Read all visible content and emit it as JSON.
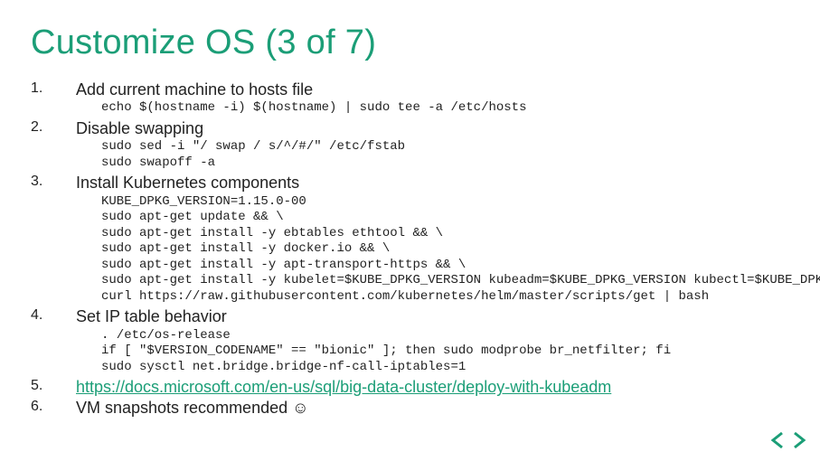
{
  "title": "Customize OS (3 of 7)",
  "items": [
    {
      "num": "1.",
      "heading": "Add current machine to hosts file",
      "code": "echo $(hostname -i) $(hostname) | sudo tee -a /etc/hosts"
    },
    {
      "num": "2.",
      "heading": "Disable swapping",
      "code": "sudo sed -i \"/ swap / s/^/#/\" /etc/fstab\nsudo swapoff -a"
    },
    {
      "num": "3.",
      "heading": "Install Kubernetes components",
      "code": "KUBE_DPKG_VERSION=1.15.0-00\nsudo apt-get update && \\\nsudo apt-get install -y ebtables ethtool && \\\nsudo apt-get install -y docker.io && \\\nsudo apt-get install -y apt-transport-https && \\\nsudo apt-get install -y kubelet=$KUBE_DPKG_VERSION kubeadm=$KUBE_DPKG_VERSION kubectl=$KUBE_DPKG_VERSION && \\\ncurl https://raw.githubusercontent.com/kubernetes/helm/master/scripts/get | bash"
    },
    {
      "num": "4.",
      "heading": "Set IP table behavior",
      "code": ". /etc/os-release\nif [ \"$VERSION_CODENAME\" == \"bionic\" ]; then sudo modprobe br_netfilter; fi\nsudo sysctl net.bridge.bridge-nf-call-iptables=1"
    },
    {
      "num": "5.",
      "link": "https://docs.microsoft.com/en-us/sql/big-data-cluster/deploy-with-kubeadm"
    },
    {
      "num": "6.",
      "heading": "VM snapshots recommended ☺"
    }
  ],
  "nav": {
    "prev": "prev",
    "next": "next"
  },
  "colors": {
    "accent": "#1b9e77"
  }
}
